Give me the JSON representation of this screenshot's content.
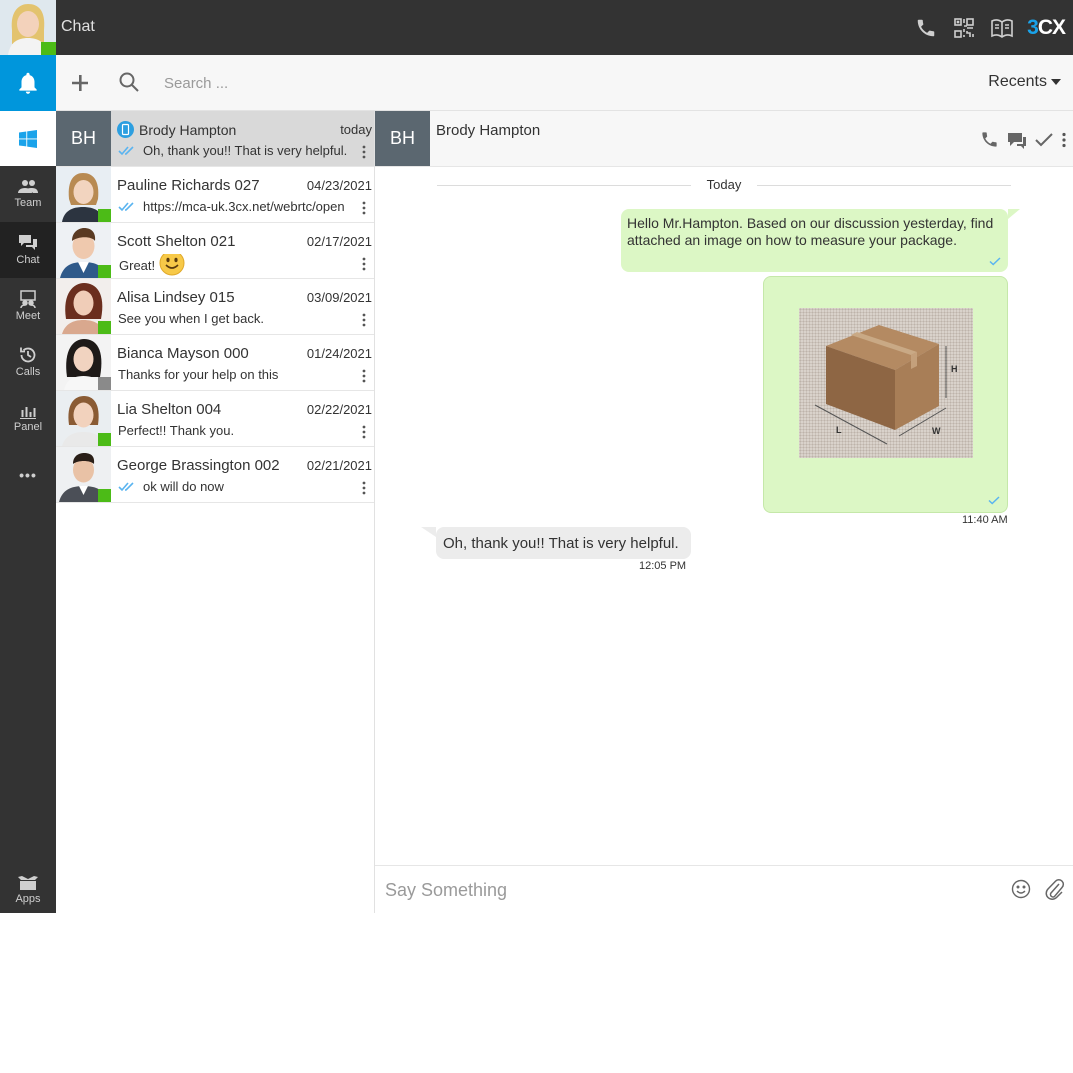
{
  "app": {
    "title": "Chat",
    "logo": "3CX"
  },
  "colors": {
    "accent": "#0096dc",
    "topbar": "#333333",
    "status_online": "#4cbb17",
    "status_away": "#8a8a8a",
    "outgoing_bubble": "#dcf7c5",
    "incoming_bubble": "#ececec",
    "check": "#5ab4f0"
  },
  "nav": {
    "team": "Team",
    "chat": "Chat",
    "meet": "Meet",
    "calls": "Calls",
    "panel": "Panel",
    "more": "•••",
    "apps": "Apps"
  },
  "toolbar": {
    "search_placeholder": "Search ...",
    "filter_label": "Recents"
  },
  "conversations": [
    {
      "initials": "BH",
      "name": "Brody Hampton",
      "date": "today",
      "preview": "Oh, thank you!! That is very helpful.",
      "status": "none",
      "read": true,
      "mobile": true
    },
    {
      "name": "Pauline Richards 027",
      "date": "04/23/2021",
      "preview": "https://mca-uk.3cx.net/webrtc/open",
      "status": "online",
      "read": true
    },
    {
      "name": "Scott Shelton 021",
      "date": "02/17/2021",
      "preview": "Great!",
      "status": "online",
      "read": false,
      "emoji": "smile-emoji"
    },
    {
      "name": "Alisa Lindsey 015",
      "date": "03/09/2021",
      "preview": "See you when I get back.",
      "status": "online",
      "read": false
    },
    {
      "name": "Bianca Mayson 000",
      "date": "01/24/2021",
      "preview": "Thanks for your help on this",
      "status": "away",
      "read": false
    },
    {
      "name": "Lia Shelton 004",
      "date": "02/22/2021",
      "preview": "Perfect!! Thank you.",
      "status": "online",
      "read": false
    },
    {
      "name": "George Brassington 002",
      "date": "02/21/2021",
      "preview": "ok will do now",
      "status": "online",
      "read": true
    }
  ],
  "chat": {
    "contact_initials": "BH",
    "contact_name": "Brody Hampton",
    "day_separator": "Today",
    "messages": [
      {
        "direction": "out",
        "type": "text",
        "text": "Hello Mr.Hampton. Based on our discussion yesterday, find attached an image on how to measure your package.",
        "read": true
      },
      {
        "direction": "out",
        "type": "image",
        "image_labels": {
          "height": "H",
          "length": "L",
          "width": "W"
        },
        "read": true,
        "time": "11:40 AM"
      },
      {
        "direction": "in",
        "type": "text",
        "text": "Oh, thank you!! That is very helpful.",
        "time": "12:05 PM"
      }
    ],
    "composer_placeholder": "Say Something"
  }
}
